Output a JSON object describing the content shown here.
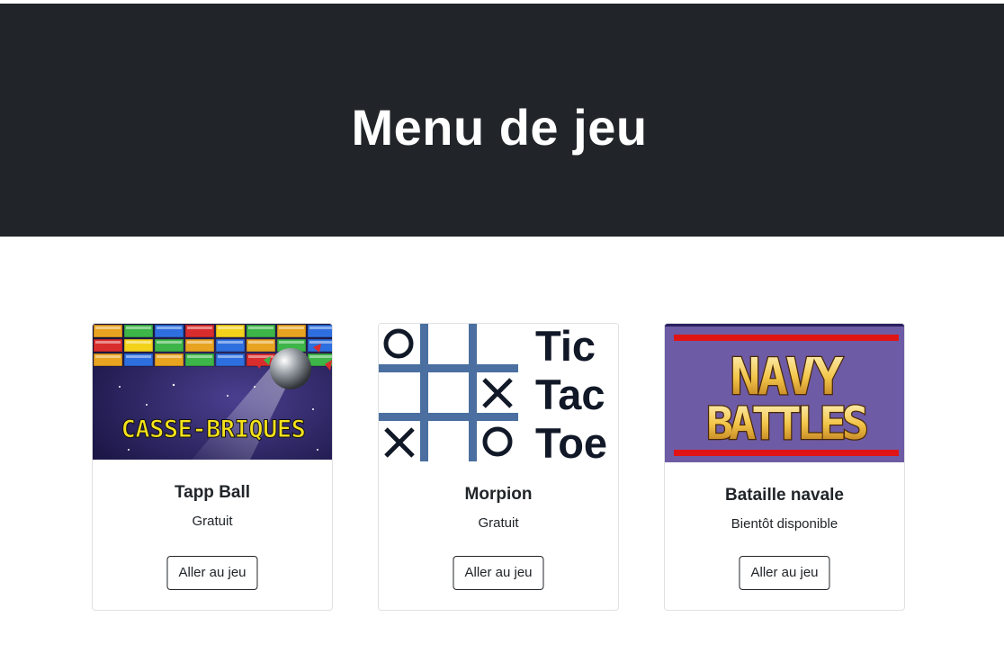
{
  "header": {
    "title": "Menu de jeu"
  },
  "games": [
    {
      "title": "Tapp Ball",
      "price": "Gratuit",
      "button": "Aller au jeu",
      "image_text": "CASSE-BRIQUES"
    },
    {
      "title": "Morpion",
      "price": "Gratuit",
      "button": "Aller au jeu",
      "image_text": [
        "Tic",
        "Tac",
        "Toe"
      ]
    },
    {
      "title": "Bataille navale",
      "price": "Bientôt disponible",
      "button": "Aller au jeu",
      "image_text": [
        "NAVY",
        "BATTLES"
      ]
    }
  ],
  "colors": {
    "header_bg": "#212529",
    "card_border": "#dfe1e3",
    "tictactoe_grid": "#4a6fa0"
  }
}
